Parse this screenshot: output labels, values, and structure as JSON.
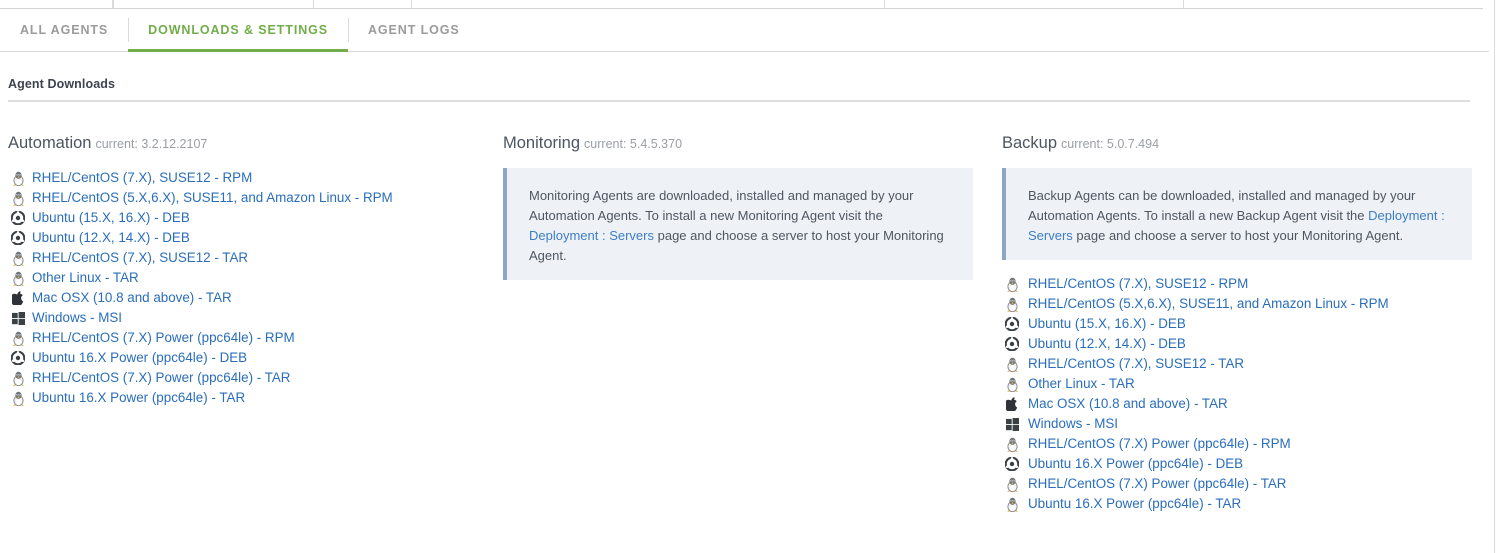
{
  "tabs": [
    {
      "label": "ALL AGENTS",
      "active": false
    },
    {
      "label": "DOWNLOADS & SETTINGS",
      "active": true
    },
    {
      "label": "AGENT LOGS",
      "active": false
    }
  ],
  "page": {
    "title": "Agent Downloads"
  },
  "colors": {
    "active_tab": "#72ad4a",
    "link": "#2a6ebb",
    "infobox_bg": "#eef2f7",
    "infobox_border": "#8aa7c4",
    "heading": "#4c5561",
    "muted": "#9a9ea3"
  },
  "columns": {
    "automation": {
      "name": "Automation",
      "version_label": "current: 3.2.12.2107",
      "downloads": [
        {
          "icon": "linux-penguin-icon",
          "label": "RHEL/CentOS (7.X), SUSE12 - RPM"
        },
        {
          "icon": "linux-penguin-icon",
          "label": "RHEL/CentOS (5.X,6.X), SUSE11, and Amazon Linux - RPM"
        },
        {
          "icon": "ubuntu-icon",
          "label": "Ubuntu (15.X, 16.X) - DEB"
        },
        {
          "icon": "ubuntu-icon",
          "label": "Ubuntu (12.X, 14.X) - DEB"
        },
        {
          "icon": "linux-penguin-icon",
          "label": "RHEL/CentOS (7.X), SUSE12 - TAR"
        },
        {
          "icon": "linux-penguin-icon",
          "label": "Other Linux - TAR"
        },
        {
          "icon": "apple-icon",
          "label": "Mac OSX (10.8 and above) - TAR"
        },
        {
          "icon": "windows-icon",
          "label": "Windows - MSI"
        },
        {
          "icon": "linux-penguin-icon",
          "label": "RHEL/CentOS (7.X) Power (ppc64le) - RPM"
        },
        {
          "icon": "ubuntu-icon",
          "label": "Ubuntu 16.X Power (ppc64le) - DEB"
        },
        {
          "icon": "linux-penguin-icon",
          "label": "RHEL/CentOS (7.X) Power (ppc64le) - TAR"
        },
        {
          "icon": "linux-penguin-icon",
          "label": "Ubuntu 16.X Power (ppc64le) - TAR"
        }
      ]
    },
    "monitoring": {
      "name": "Monitoring",
      "version_label": "current: 5.4.5.370",
      "info": {
        "text_before_link": "Monitoring Agents are downloaded, installed and managed by your Automation Agents. To install a new Monitoring Agent visit the ",
        "link_text": "Deployment : Servers",
        "text_after_link": " page and choose a server to host your Monitoring Agent."
      }
    },
    "backup": {
      "name": "Backup",
      "version_label": "current: 5.0.7.494",
      "info": {
        "text_before_link": "Backup Agents can be downloaded, installed and managed by your Automation Agents. To install a new Backup Agent visit the ",
        "link_text": "Deployment : Servers",
        "text_after_link": " page and choose a server to host your Monitoring Agent."
      },
      "downloads": [
        {
          "icon": "linux-penguin-icon",
          "label": "RHEL/CentOS (7.X), SUSE12 - RPM"
        },
        {
          "icon": "linux-penguin-icon",
          "label": "RHEL/CentOS (5.X,6.X), SUSE11, and Amazon Linux - RPM"
        },
        {
          "icon": "ubuntu-icon",
          "label": "Ubuntu (15.X, 16.X) - DEB"
        },
        {
          "icon": "ubuntu-icon",
          "label": "Ubuntu (12.X, 14.X) - DEB"
        },
        {
          "icon": "linux-penguin-icon",
          "label": "RHEL/CentOS (7.X), SUSE12 - TAR"
        },
        {
          "icon": "linux-penguin-icon",
          "label": "Other Linux - TAR"
        },
        {
          "icon": "apple-icon",
          "label": "Mac OSX (10.8 and above) - TAR"
        },
        {
          "icon": "windows-icon",
          "label": "Windows - MSI"
        },
        {
          "icon": "linux-penguin-icon",
          "label": "RHEL/CentOS (7.X) Power (ppc64le) - RPM"
        },
        {
          "icon": "ubuntu-icon",
          "label": "Ubuntu 16.X Power (ppc64le) - DEB"
        },
        {
          "icon": "linux-penguin-icon",
          "label": "RHEL/CentOS (7.X) Power (ppc64le) - TAR"
        },
        {
          "icon": "linux-penguin-icon",
          "label": "Ubuntu 16.X Power (ppc64le) - TAR"
        }
      ]
    }
  }
}
